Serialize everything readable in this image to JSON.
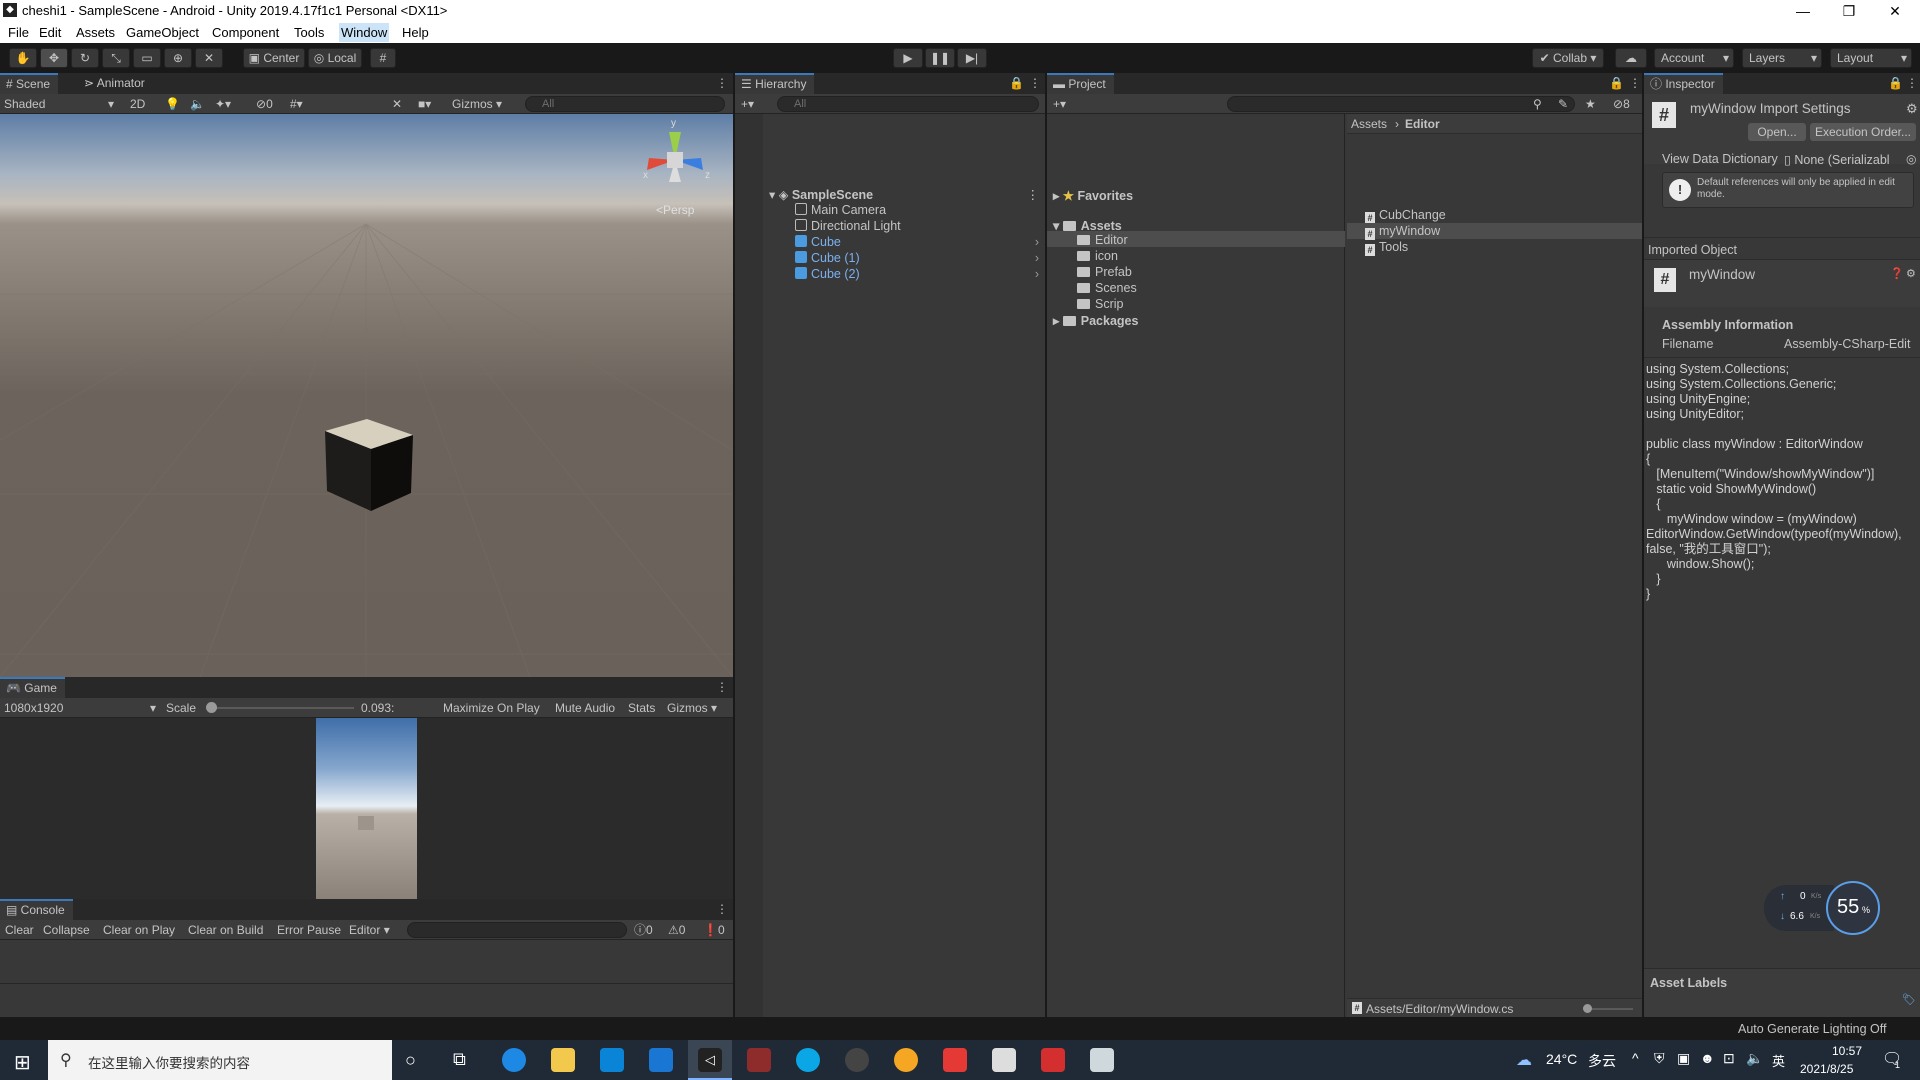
{
  "window": {
    "title": "cheshi1 - SampleScene - Android - Unity 2019.4.17f1c1 Personal <DX11>",
    "minimize": "—",
    "restore": "❐",
    "close": "✕"
  },
  "menu": [
    "File",
    "Edit",
    "Assets",
    "GameObject",
    "Component",
    "Tools",
    "Window",
    "Help"
  ],
  "toolbar": {
    "pivot": "Center",
    "space": "Local",
    "collab": "Collab",
    "account": "Account",
    "layers": "Layers",
    "layout": "Layout"
  },
  "scene": {
    "tab_scene": "Scene",
    "tab_animator": "Animator",
    "shading": "Shaded",
    "mode2d": "2D",
    "hidden_count": "0",
    "gizmos": "Gizmos",
    "search_placeholder": "All",
    "persp": "Persp",
    "axis_y": "y",
    "axis_x": "x",
    "axis_z": "z"
  },
  "game": {
    "tab": "Game",
    "resolution": "1080x1920",
    "scale_label": "Scale",
    "scale_value": "0.093:",
    "maximize": "Maximize On Play",
    "mute": "Mute Audio",
    "stats": "Stats",
    "gizmos": "Gizmos"
  },
  "console": {
    "tab": "Console",
    "clear": "Clear",
    "collapse": "Collapse",
    "clear_on_play": "Clear on Play",
    "clear_on_build": "Clear on Build",
    "error_pause": "Error Pause",
    "editor": "Editor",
    "log_count": "0",
    "warn_count": "0",
    "error_count": "0"
  },
  "hierarchy": {
    "tab": "Hierarchy",
    "search_placeholder": "All",
    "scene": "SampleScene",
    "items": [
      "Main Camera",
      "Directional Light",
      "Cube",
      "Cube (1)",
      "Cube (2)"
    ]
  },
  "project": {
    "tab": "Project",
    "hidden_count": "8",
    "favorites": "Favorites",
    "assets": "Assets",
    "folders": [
      "Editor",
      "icon",
      "Prefab",
      "Scenes",
      "Scrip"
    ],
    "packages": "Packages",
    "breadcrumb_root": "Assets",
    "breadcrumb_current": "Editor",
    "files": [
      "CubChange",
      "myWindow",
      "Tools"
    ],
    "footer_path": "Assets/Editor/myWindow.cs"
  },
  "inspector": {
    "tab": "Inspector",
    "title": "myWindow Import Settings",
    "open_btn": "Open...",
    "exec_order_btn": "Execution Order...",
    "view_data_label": "View Data Dictionary",
    "view_data_value": "None (Serializabl",
    "warning": "Default references will only be applied in edit mode.",
    "imported_object": "Imported Object",
    "object_name": "myWindow",
    "assembly_info": "Assembly Information",
    "filename_label": "Filename",
    "filename_value": "Assembly-CSharp-Edit",
    "code": "using System.Collections;\nusing System.Collections.Generic;\nusing UnityEngine;\nusing UnityEditor;\n\npublic class myWindow : EditorWindow\n{\n   [MenuItem(\"Window/showMyWindow\")]\n   static void ShowMyWindow()\n   {\n      myWindow window = (myWindow)\nEditorWindow.GetWindow(typeof(myWindow),\nfalse, \"我的工具窗口\");\n      window.Show();\n   }\n}",
    "asset_labels": "Asset Labels",
    "net_up": "0",
    "net_up_unit": "K/s",
    "net_down": "6.6",
    "net_down_unit": "K/s",
    "cpu_percent": "55",
    "cpu_unit": "%"
  },
  "statusbar": {
    "lighting": "Auto Generate Lighting Off"
  },
  "taskbar": {
    "search_placeholder": "在这里输入你要搜索的内容",
    "weather_temp": "24°C",
    "weather_desc": "多云",
    "ime": "英",
    "time": "10:57",
    "date": "2021/8/25",
    "notifications": "1"
  },
  "colors": {
    "accent": "#3a79bb",
    "panel": "#383838",
    "header": "#282828",
    "selected_row": "#4d4d4d",
    "link_blue": "#7bb0ef"
  }
}
